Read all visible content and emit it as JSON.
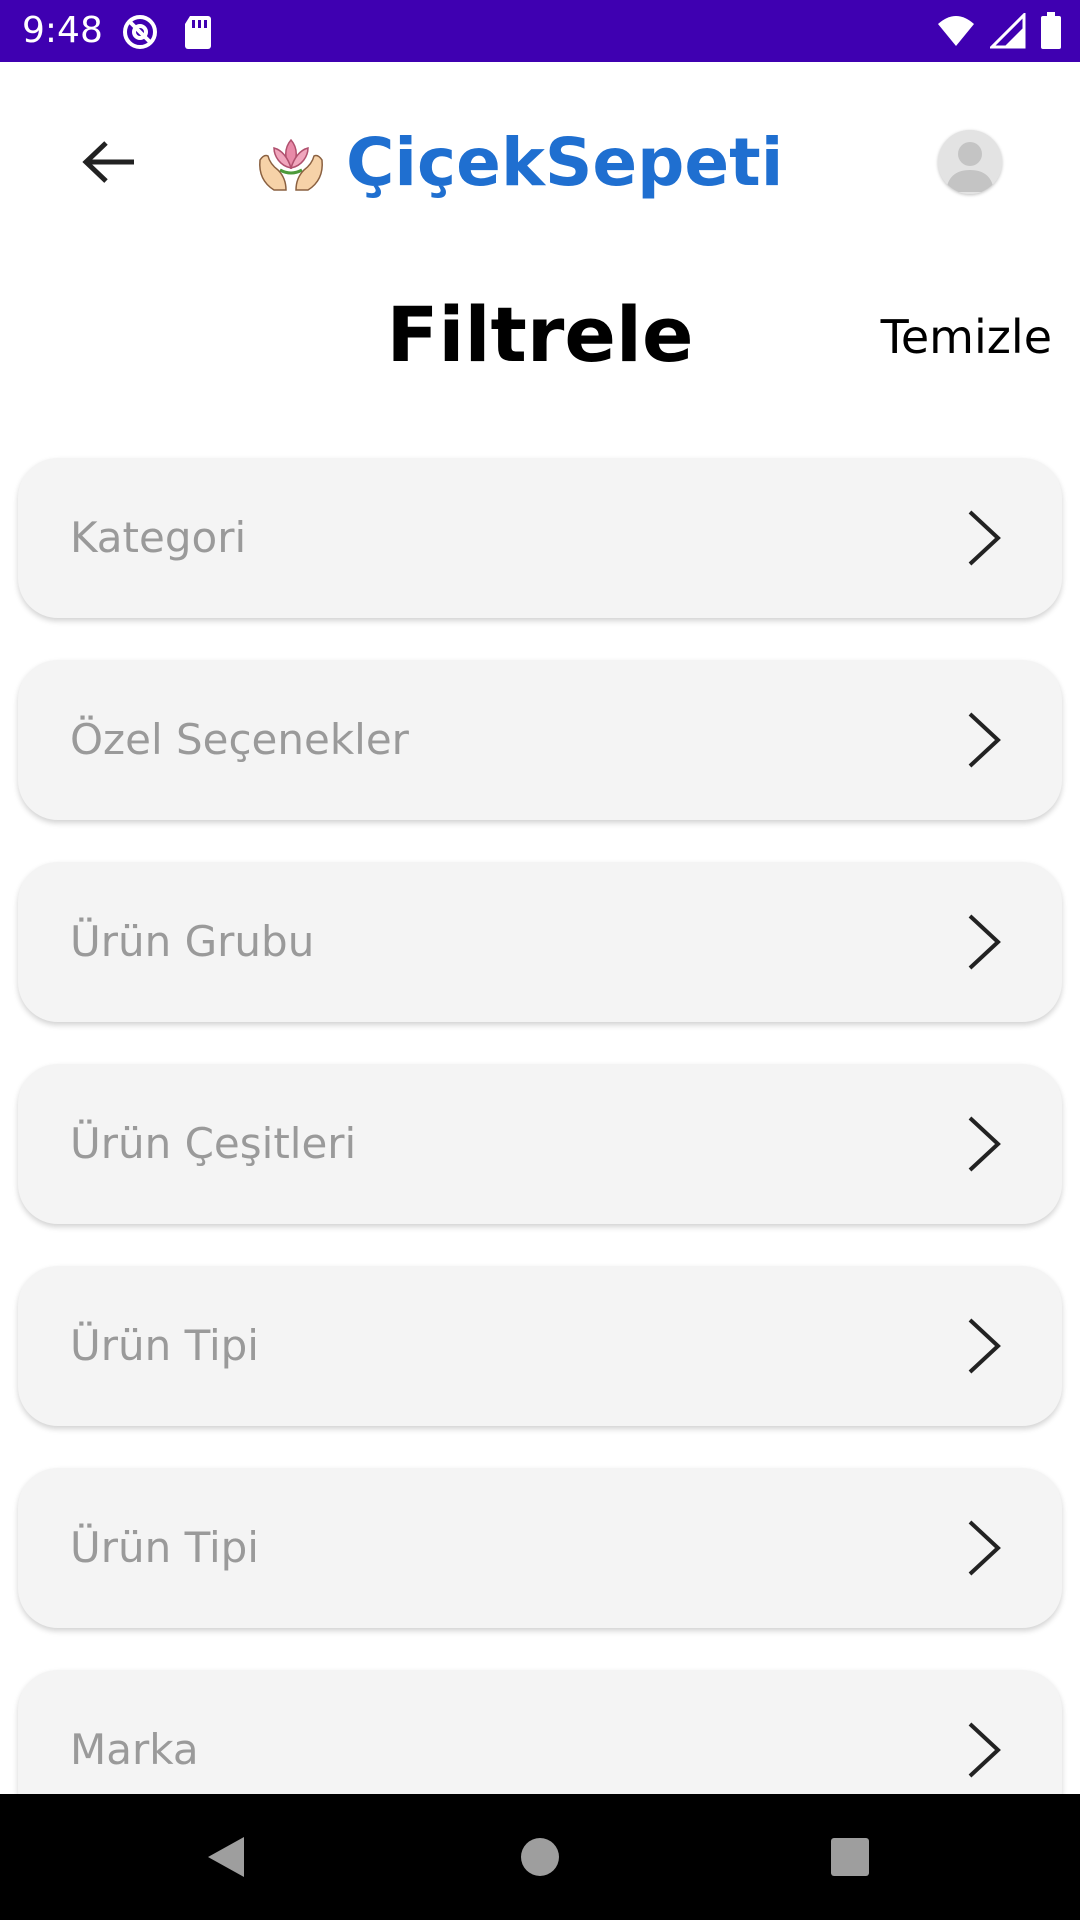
{
  "status_bar": {
    "time": "9:48",
    "background_color": "#3f00b1",
    "icons_left": [
      "at-sign-icon",
      "sd-card-icon"
    ],
    "icons_right": [
      "wifi-icon",
      "signal-icon",
      "battery-icon"
    ]
  },
  "header": {
    "back_icon": "arrow-left-icon",
    "logo_icon": "lotus-hands-icon",
    "brand_name": "ÇiçekSepeti",
    "brand_color": "#1f6fd0",
    "avatar_icon": "user-avatar-icon"
  },
  "title_row": {
    "title": "Filtrele",
    "clear_label": "Temizle"
  },
  "filters": [
    {
      "label": "Kategori"
    },
    {
      "label": "Özel Seçenekler"
    },
    {
      "label": "Ürün Grubu"
    },
    {
      "label": "Ürün Çeşitleri"
    },
    {
      "label": "Ürün Tipi"
    },
    {
      "label": "Ürün Tipi"
    },
    {
      "label": "Marka"
    }
  ],
  "nav_bar": {
    "buttons": [
      "back-triangle-icon",
      "home-circle-icon",
      "recents-square-icon"
    ]
  }
}
